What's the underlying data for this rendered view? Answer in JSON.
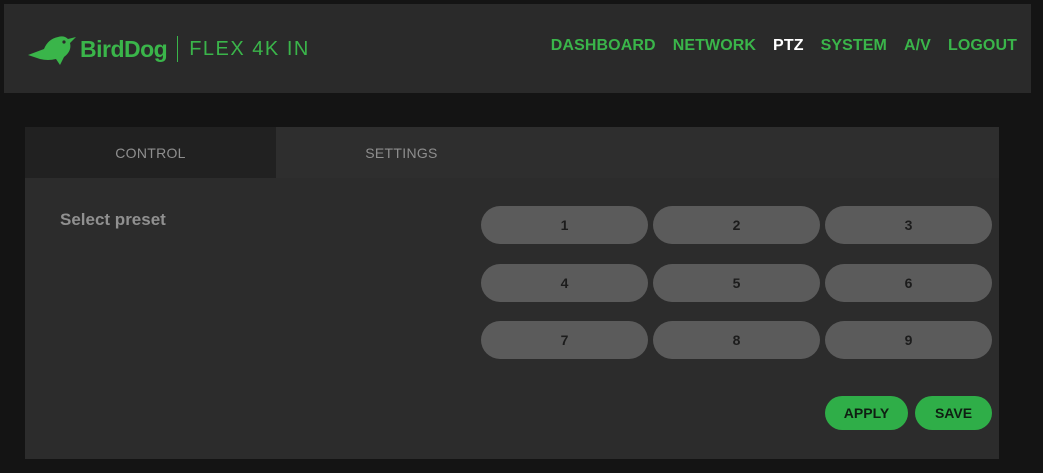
{
  "header": {
    "brand": "BirdDog",
    "product": "FLEX 4K IN",
    "nav": [
      "DASHBOARD",
      "NETWORK",
      "PTZ",
      "SYSTEM",
      "A/V",
      "LOGOUT"
    ],
    "active_nav": "PTZ"
  },
  "tabs": [
    "CONTROL",
    "SETTINGS"
  ],
  "content": {
    "select_label": "Select preset",
    "presets": [
      "1",
      "2",
      "3",
      "4",
      "5",
      "6",
      "7",
      "8",
      "9"
    ],
    "apply_label": "APPLY",
    "save_label": "SAVE"
  },
  "colors": {
    "accent": "#3ab54a",
    "button_green": "#2fae48",
    "preset_bg": "#5b5b5b"
  }
}
